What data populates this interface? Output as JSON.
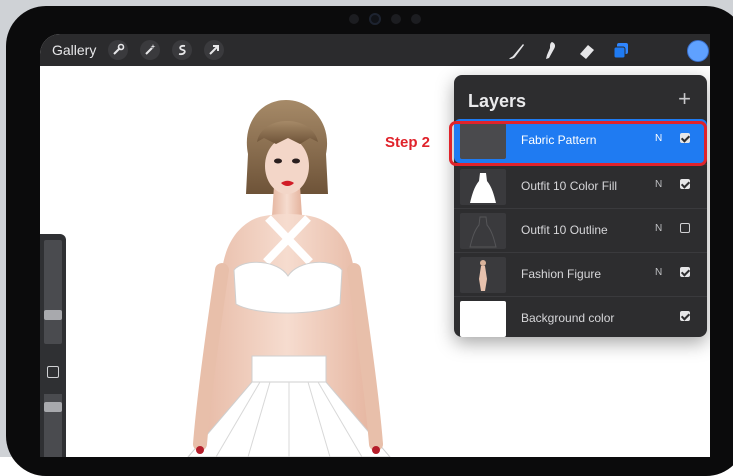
{
  "toolbar": {
    "gallery_label": "Gallery",
    "actions": [
      {
        "icon": "wrench-icon"
      },
      {
        "icon": "magic-wand-icon"
      },
      {
        "icon": "selection-icon"
      },
      {
        "icon": "transform-arrow-icon"
      }
    ],
    "tools": [
      {
        "icon": "brush-icon"
      },
      {
        "icon": "smudge-icon"
      },
      {
        "icon": "eraser-icon"
      },
      {
        "icon": "layers-icon",
        "active": true
      }
    ],
    "color_swatch": "#5fa1ff"
  },
  "layers_panel": {
    "title": "Layers",
    "add_label": "+",
    "layers": [
      {
        "name": "Fabric Pattern",
        "blend": "N",
        "visible": true,
        "selected": true,
        "thumb": "blank-gray"
      },
      {
        "name": "Outfit 10 Color Fill",
        "blend": "N",
        "visible": true,
        "selected": false,
        "thumb": "dress-white"
      },
      {
        "name": "Outfit 10 Outline",
        "blend": "N",
        "visible": false,
        "selected": false,
        "thumb": "dress-outline"
      },
      {
        "name": "Fashion Figure",
        "blend": "N",
        "visible": true,
        "selected": false,
        "thumb": "figure"
      },
      {
        "name": "Background color",
        "blend": "",
        "visible": true,
        "selected": false,
        "thumb": "white"
      }
    ]
  },
  "annotation": {
    "step_label": "Step 2",
    "color": "#e0232b"
  },
  "colors": {
    "accent": "#1f7bf2",
    "toolbar_bg": "#2b2b2d",
    "panel_bg": "#2d2d2f"
  }
}
